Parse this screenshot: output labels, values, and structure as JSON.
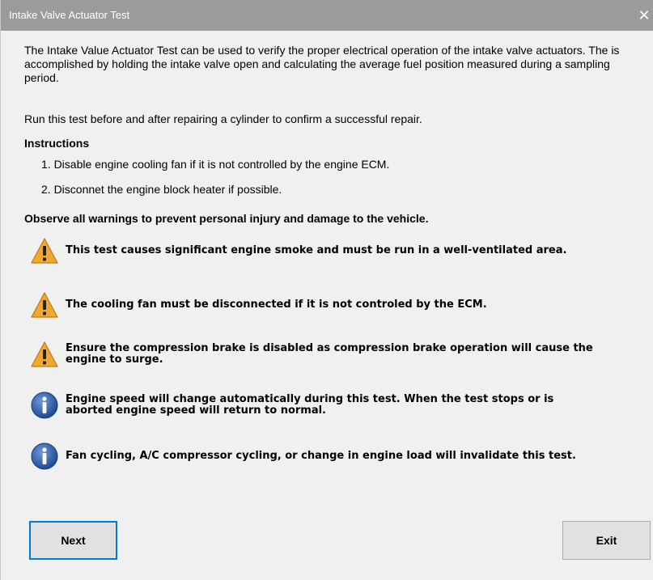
{
  "window": {
    "title": "Intake Valve Actuator Test",
    "close_glyph": "✕"
  },
  "intro": "The Intake Value Actuator Test can be used to verify the proper electrical operation of the intake valve actuators.  The is accomplished by holding the intake valve open and calculating the average fuel position measured during a sampling period.",
  "run_note": "Run this test before and after repairing a cylinder to confirm a successful repair.",
  "instructions": {
    "heading": "Instructions",
    "steps": [
      "1. Disable engine cooling fan if it is not controlled by the engine ECM.",
      "2. Disconnet the engine block heater if possible."
    ]
  },
  "observe": "Observe all warnings to prevent personal injury and damage to the vehicle.",
  "notices": [
    {
      "type": "warning",
      "icon": "warning-icon",
      "text": "This test causes significant engine smoke and must be run in a well-ventilated area."
    },
    {
      "type": "warning",
      "icon": "warning-icon",
      "text": "The cooling fan must be disconnected if it is not controled by the ECM."
    },
    {
      "type": "warning",
      "icon": "warning-icon",
      "text": "Ensure the compression brake is disabled as compression brake operation will cause the engine to surge."
    },
    {
      "type": "info",
      "icon": "info-icon",
      "text": "Engine speed will change automatically during this test. When the test stops or is aborted engine speed will return to normal."
    },
    {
      "type": "info",
      "icon": "info-icon",
      "text": "Fan cycling, A/C compressor cycling, or change in engine load will invalidate this test."
    }
  ],
  "buttons": {
    "next": "Next",
    "exit": "Exit"
  },
  "colors": {
    "titlebar": "#9b9b9b",
    "warning": "#f0a830",
    "info": "#2f5da8",
    "focus_border": "#0078d7"
  }
}
